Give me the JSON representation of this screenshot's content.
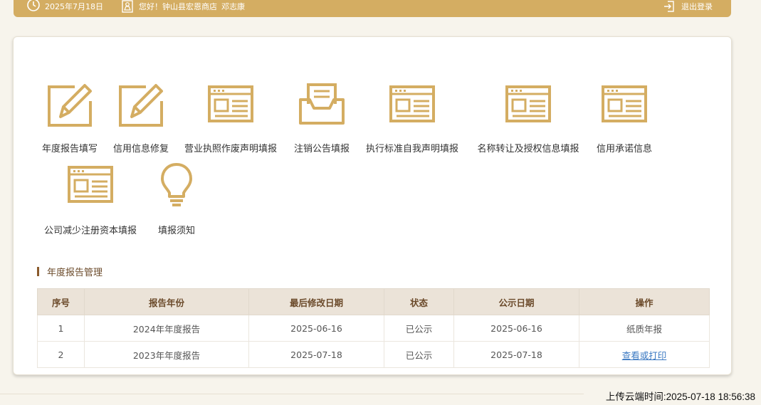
{
  "header": {
    "date": "2025年7月18日",
    "greeting": "您好！钟山县宏恩商店",
    "user": "邓志康",
    "logout": "退出登录"
  },
  "tiles": [
    {
      "label": "年度报告填写",
      "icon": "edit-pencil-icon"
    },
    {
      "label": "信用信息修复",
      "icon": "edit-pencil-icon"
    },
    {
      "label": "营业执照作废声明填报",
      "icon": "form-window-icon"
    },
    {
      "label": "注销公告填报",
      "icon": "inbox-tray-icon"
    },
    {
      "label": "执行标准自我声明填报",
      "icon": "form-window-icon"
    },
    {
      "label": "名称转让及授权信息填报",
      "icon": "form-window-icon"
    },
    {
      "label": "信用承诺信息",
      "icon": "form-window-icon"
    },
    {
      "label": "公司减少注册资本填报",
      "icon": "form-window-icon"
    },
    {
      "label": "填报须知",
      "icon": "lightbulb-icon"
    }
  ],
  "section": {
    "title": "年度报告管理"
  },
  "table": {
    "headers": [
      "序号",
      "报告年份",
      "最后修改日期",
      "状态",
      "公示日期",
      "操作"
    ],
    "rows": [
      [
        "1",
        "2024年年度报告",
        "2025-06-16",
        "已公示",
        "2025-06-16",
        "纸质年报"
      ],
      [
        "2",
        "2023年年度报告",
        "2025-07-18",
        "已公示",
        "2025-07-18",
        "查看或打印"
      ]
    ]
  },
  "footer": {
    "upload_time": "上传云端时间:2025-07-18 18:56:38"
  },
  "colors": {
    "accent": "#d4ad62",
    "header_bg": "#ebe3d8",
    "link": "#3b79c2"
  }
}
